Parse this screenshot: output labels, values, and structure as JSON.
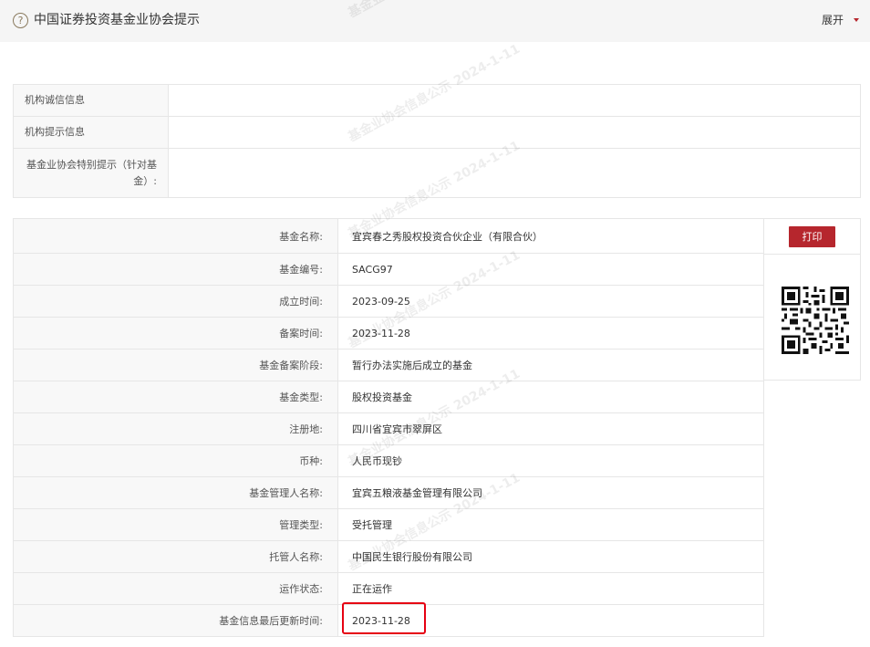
{
  "header": {
    "title": "中国证券投资基金业协会提示",
    "expand_label": "展开",
    "help_glyph": "?"
  },
  "institution_table": [
    {
      "label": "机构诚信信息",
      "value": ""
    },
    {
      "label": "机构提示信息",
      "value": ""
    },
    {
      "label": "基金业协会特别提示（针对基金）:",
      "value": ""
    }
  ],
  "fund_info": [
    {
      "label": "基金名称:",
      "value": "宜宾春之秀股权投资合伙企业（有限合伙）"
    },
    {
      "label": "基金编号:",
      "value": "SACG97"
    },
    {
      "label": "成立时间:",
      "value": "2023-09-25"
    },
    {
      "label": "备案时间:",
      "value": "2023-11-28"
    },
    {
      "label": "基金备案阶段:",
      "value": "暂行办法实施后成立的基金"
    },
    {
      "label": "基金类型:",
      "value": "股权投资基金"
    },
    {
      "label": "注册地:",
      "value": "四川省宜宾市翠屏区"
    },
    {
      "label": "币种:",
      "value": "人民币现钞"
    },
    {
      "label": "基金管理人名称:",
      "value": "宜宾五粮液基金管理有限公司"
    },
    {
      "label": "管理类型:",
      "value": "受托管理"
    },
    {
      "label": "托管人名称:",
      "value": "中国民生银行股份有限公司"
    },
    {
      "label": "运作状态:",
      "value": "正在运作"
    },
    {
      "label": "基金信息最后更新时间:",
      "value": "2023-11-28"
    }
  ],
  "sidebar": {
    "print_label": "打印"
  },
  "watermark": {
    "text": "基金业协会信息公示 2024-1-11"
  },
  "colors": {
    "accent_red": "#b6262d",
    "highlight_red": "#e60012",
    "label_bg": "#f8f8f8",
    "border": "#e6e6e6"
  }
}
